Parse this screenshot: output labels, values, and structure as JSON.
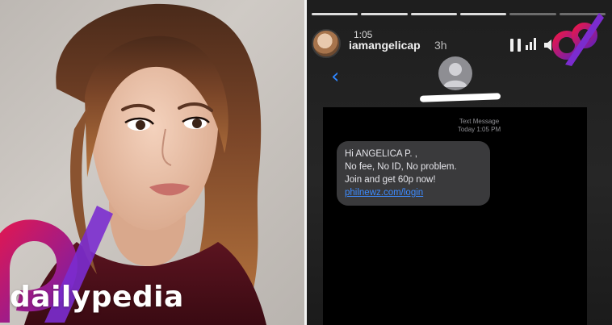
{
  "brand": {
    "name": "dailypedia"
  },
  "story": {
    "status_time": "1:05",
    "username": "iamangelicap",
    "age": "3h",
    "progress_segments": 6,
    "progress_done": 4
  },
  "message_app": {
    "header_label": "Text Message",
    "timestamp": "Today 1:05 PM",
    "message_lines": [
      "Hi ANGELICA P. ,",
      "No fee, No ID, No problem.",
      "Join and get 60p now!"
    ],
    "link_text": "philnewz.com/login"
  },
  "colors": {
    "brand_gradient_start": "#e8174b",
    "brand_gradient_end": "#6a1fb5",
    "ios_link_blue": "#3d8bff",
    "bubble_gray": "#3a3a3c"
  },
  "icons": [
    "pause-icon",
    "signal-icon",
    "mute-icon",
    "back-chevron-icon",
    "contact-avatar-icon",
    "brand-logo-icon"
  ]
}
